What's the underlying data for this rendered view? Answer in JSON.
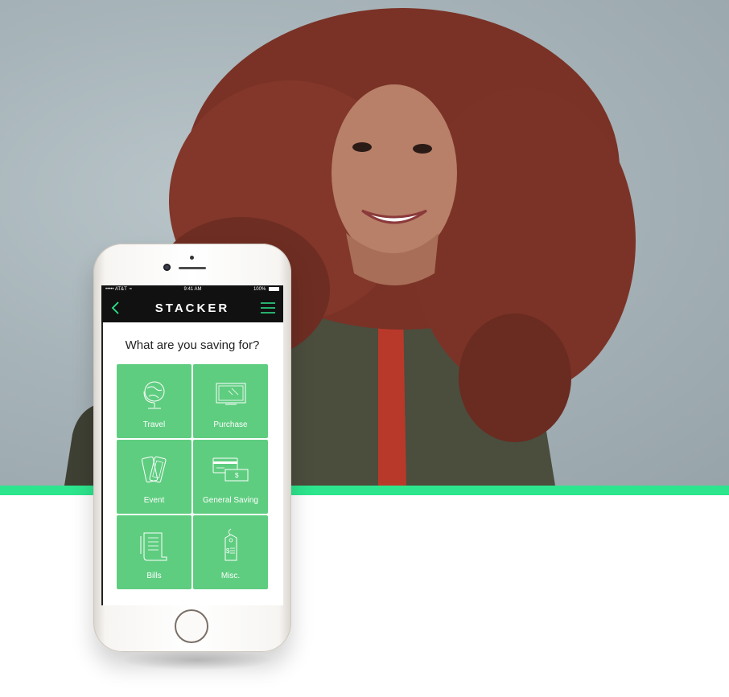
{
  "colors": {
    "accent": "#2de58d",
    "tile": "#5fcd80",
    "nav_bg": "#111111",
    "nav_icon": "#2de58d"
  },
  "statusbar": {
    "carrier": "••••• AT&T",
    "time": "9:41 AM",
    "battery": "100%"
  },
  "app": {
    "title": "STACKER",
    "back_icon": "chevron-left-icon",
    "menu_icon": "hamburger-menu-icon"
  },
  "main": {
    "question": "What are you saving for?",
    "categories": [
      {
        "label": "Travel",
        "icon": "globe-icon"
      },
      {
        "label": "Purchase",
        "icon": "monitor-icon"
      },
      {
        "label": "Event",
        "icon": "tickets-icon"
      },
      {
        "label": "General Saving",
        "icon": "card-and-cash-icon"
      },
      {
        "label": "Bills",
        "icon": "receipt-icon"
      },
      {
        "label": "Misc.",
        "icon": "price-tag-icon"
      }
    ]
  }
}
